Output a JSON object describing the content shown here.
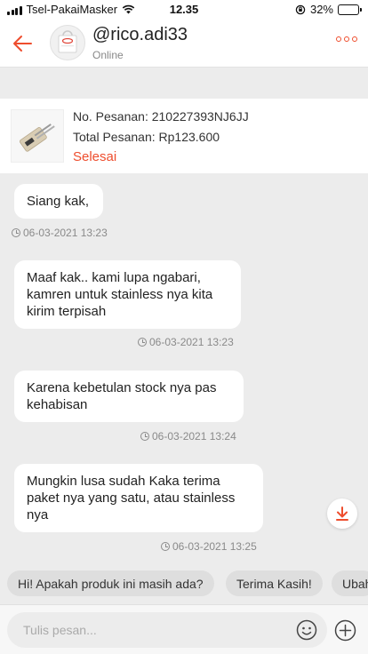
{
  "status_bar": {
    "carrier": "Tsel-PakaiMasker",
    "time": "12.35",
    "battery": "32%",
    "battery_level": 0.32
  },
  "header": {
    "shop_name": "@rico.adi33",
    "status": "Online"
  },
  "order": {
    "order_number": "No. Pesanan: 210227393NJ6JJ",
    "order_total": "Total Pesanan: Rp123.600",
    "status": "Selesai"
  },
  "messages": [
    {
      "text": "Siang kak,",
      "timestamp": "06-03-2021 13:23"
    },
    {
      "text": "Maaf kak.. kami lupa ngabari, kamren untuk stainless nya kita kirim terpisah",
      "timestamp": "06-03-2021 13:23"
    },
    {
      "text": "Karena kebetulan stock nya pas kehabisan",
      "timestamp": "06-03-2021 13:24"
    },
    {
      "text": "Mungkin lusa sudah Kaka terima paket nya yang satu, atau stainless nya",
      "timestamp": "06-03-2021 13:25"
    }
  ],
  "quick_replies": [
    "Hi! Apakah produk ini masih ada?",
    "Terima Kasih!",
    "Ubah"
  ],
  "input": {
    "placeholder": "Tulis pesan..."
  },
  "colors": {
    "accent": "#ee4d2d"
  },
  "icons": {
    "back": "arrow-left-icon",
    "more": "more-dots-icon",
    "clock": "clock-icon",
    "scroll_down": "arrow-down-icon",
    "emoji": "emoji-icon",
    "add": "plus-circle-icon"
  }
}
